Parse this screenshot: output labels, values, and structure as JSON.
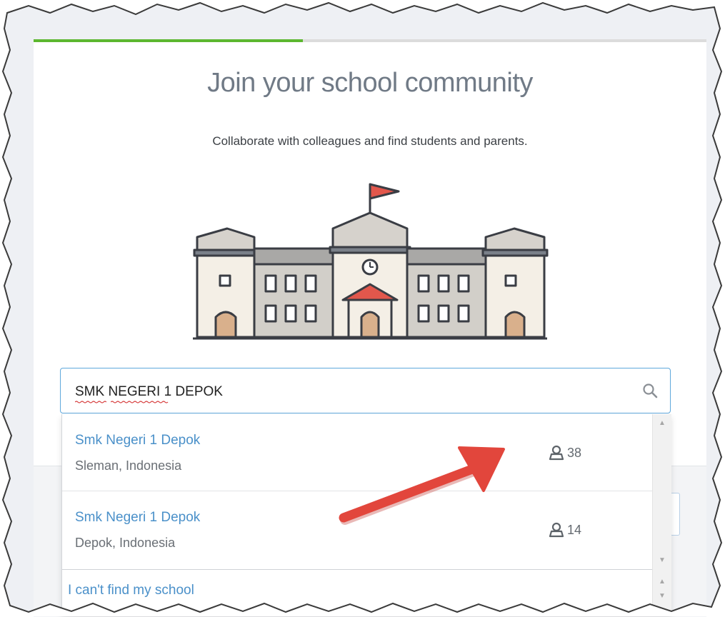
{
  "page": {
    "title": "Join your school community",
    "subtitle": "Collaborate with colleagues and find students and parents.",
    "progress_fraction": 0.4
  },
  "search": {
    "value": "SMK NEGERI 1 DEPOK",
    "icon": "search-icon"
  },
  "results": [
    {
      "name": "Smk Negeri 1 Depok",
      "location": "Sleman, Indonesia",
      "members": "38",
      "icon": "user-icon"
    },
    {
      "name": "Smk Negeri 1 Depok",
      "location": "Depok, Indonesia",
      "members": "14",
      "icon": "user-icon"
    }
  ],
  "cant_find_label": "I can't find my school",
  "colors": {
    "progress": "#5cb72f",
    "link": "#4a90c9",
    "annotation_arrow": "#e2463c",
    "input_focus_border": "#5fa8dc"
  },
  "scroll_up_glyph": "▲",
  "scroll_down_glyph": "▼"
}
